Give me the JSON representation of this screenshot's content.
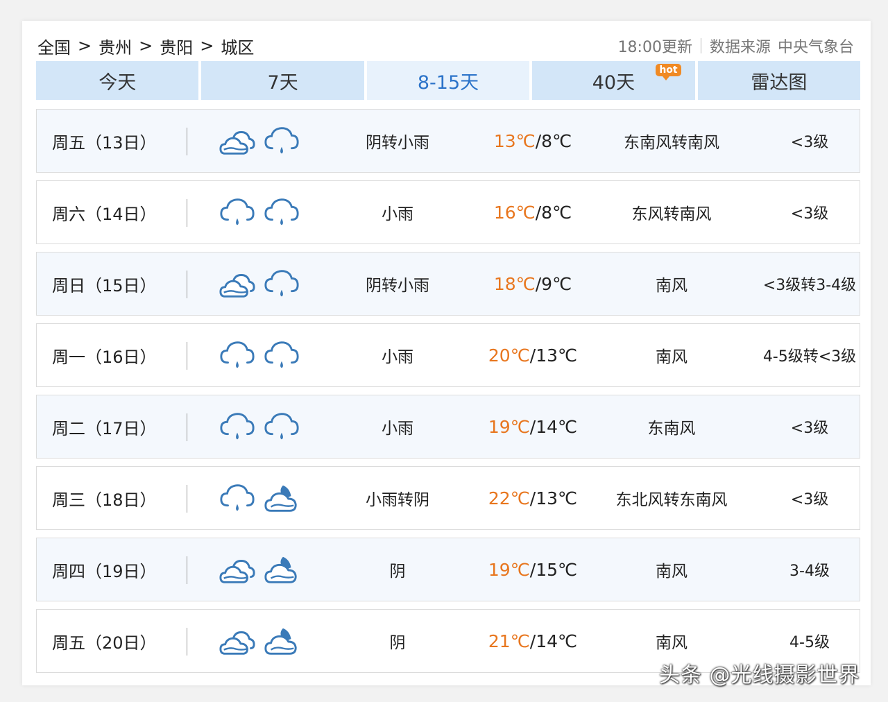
{
  "breadcrumb": [
    "全国",
    "贵州",
    "贵阳",
    "城区"
  ],
  "breadcrumb_sep": ">",
  "update_time": "18:00更新",
  "source_label": "数据来源",
  "source_name": "中央气象台",
  "tabs": [
    {
      "label": "今天"
    },
    {
      "label": "7天"
    },
    {
      "label": "8-15天",
      "active": true
    },
    {
      "label": "40天",
      "badge": "hot"
    },
    {
      "label": "雷达图"
    }
  ],
  "forecast": [
    {
      "day": "周五（13日）",
      "icons": [
        "overcast-icon",
        "light-rain-icon"
      ],
      "desc": "阴转小雨",
      "high": "13℃",
      "low": "/8℃",
      "wind": "东南风转南风",
      "level": "<3级"
    },
    {
      "day": "周六（14日）",
      "icons": [
        "light-rain-icon",
        "light-rain-icon"
      ],
      "desc": "小雨",
      "high": "16℃",
      "low": "/8℃",
      "wind": "东风转南风",
      "level": "<3级"
    },
    {
      "day": "周日（15日）",
      "icons": [
        "overcast-icon",
        "light-rain-icon"
      ],
      "desc": "阴转小雨",
      "high": "18℃",
      "low": "/9℃",
      "wind": "南风",
      "level": "<3级转3-4级"
    },
    {
      "day": "周一（16日）",
      "icons": [
        "light-rain-icon",
        "light-rain-icon"
      ],
      "desc": "小雨",
      "high": "20℃",
      "low": "/13℃",
      "wind": "南风",
      "level": "4-5级转<3级"
    },
    {
      "day": "周二（17日）",
      "icons": [
        "light-rain-icon",
        "light-rain-icon"
      ],
      "desc": "小雨",
      "high": "19℃",
      "low": "/14℃",
      "wind": "东南风",
      "level": "<3级"
    },
    {
      "day": "周三（18日）",
      "icons": [
        "light-rain-icon",
        "overcast-night-icon"
      ],
      "desc": "小雨转阴",
      "high": "22℃",
      "low": "/13℃",
      "wind": "东北风转东南风",
      "level": "<3级"
    },
    {
      "day": "周四（19日）",
      "icons": [
        "overcast-icon",
        "overcast-night-icon"
      ],
      "desc": "阴",
      "high": "19℃",
      "low": "/15℃",
      "wind": "南风",
      "level": "3-4级"
    },
    {
      "day": "周五（20日）",
      "icons": [
        "overcast-icon",
        "overcast-night-icon"
      ],
      "desc": "阴",
      "high": "21℃",
      "low": "/14℃",
      "wind": "南风",
      "level": "4-5级"
    }
  ],
  "watermark": "头条 @光线摄影世界",
  "colors": {
    "accent": "#2b73c9",
    "high_temp": "#e8761e",
    "tab_bg": "#d3e6f8",
    "icon": "#3a7ab8"
  }
}
